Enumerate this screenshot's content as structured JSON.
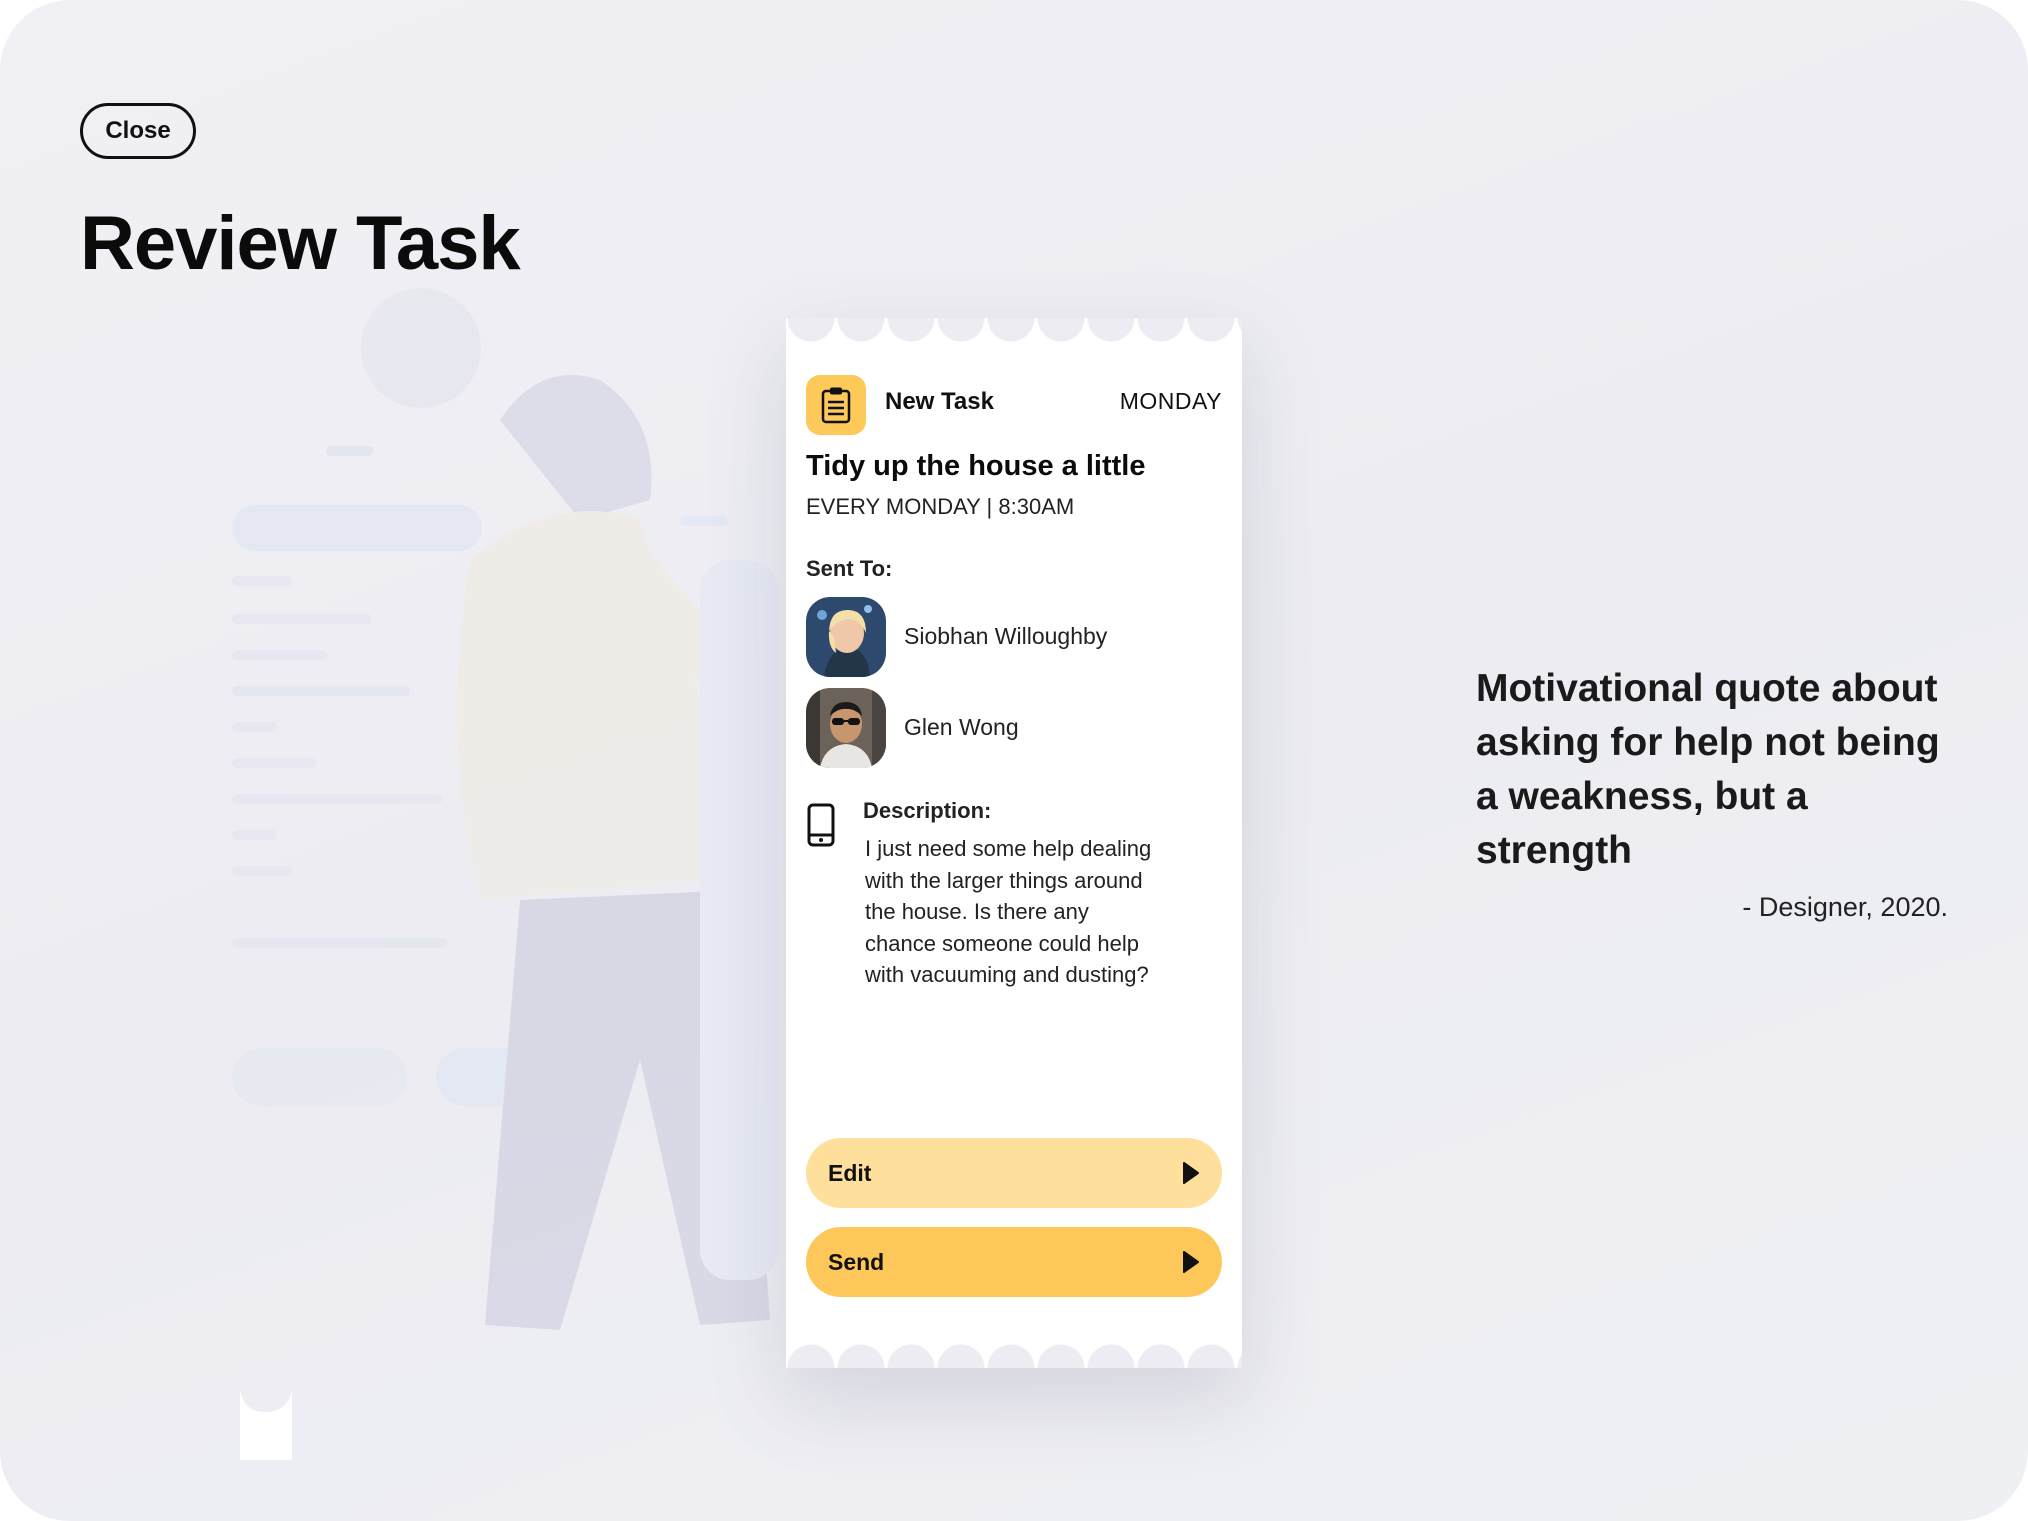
{
  "page": {
    "close_label": "Close",
    "title": "Review Task"
  },
  "task": {
    "icon": "clipboard-icon",
    "kind": "New Task",
    "day": "MONDAY",
    "title": "Tidy up the house a little",
    "schedule": "EVERY MONDAY | 8:30AM",
    "sent_to_label": "Sent To:",
    "recipients": [
      {
        "name": "Siobhan Willoughby"
      },
      {
        "name": "Glen Wong"
      }
    ],
    "description_icon": "phone-icon",
    "description_label": "Description:",
    "description": "I just need some help dealing with the larger things around the house. Is there any chance someone could help with vacuuming and dusting?"
  },
  "actions": {
    "edit_label": "Edit",
    "send_label": "Send"
  },
  "quote": {
    "text": "Motivational quote about asking for help not being a weakness, but a strength",
    "attribution": "- Designer, 2020."
  },
  "colors": {
    "accent": "#fdc958",
    "edit_button": "#fedf9b",
    "send_button": "#fdc75a",
    "background": "#ececf2"
  }
}
